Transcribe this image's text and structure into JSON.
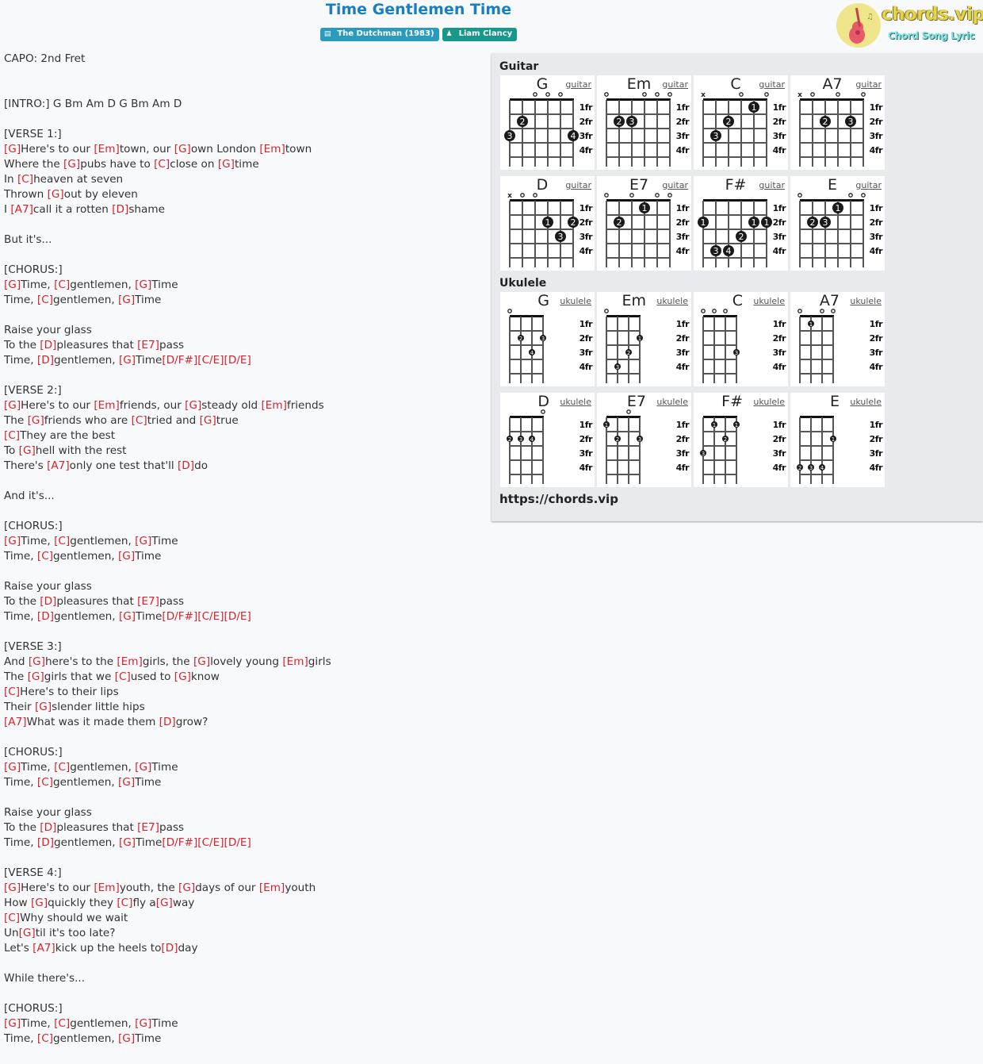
{
  "header": {
    "title": "Time Gentlemen Time",
    "album_badge": "The Dutchman (1983)",
    "artist_badge": "Liam Clancy",
    "album_icon": "book-icon",
    "artist_icon": "user-icon"
  },
  "logo": {
    "brand": "chords.vip",
    "tagline": "Chord Song Lyric",
    "icon": "guitar-icon"
  },
  "lyrics": [
    [
      {
        "t": "CAPO: 2nd Fret"
      }
    ],
    [],
    [],
    [
      {
        "t": "[INTRO:] G Bm Am D G Bm Am D"
      }
    ],
    [],
    [
      {
        "t": "[VERSE 1:]"
      }
    ],
    [
      {
        "c": "[G]"
      },
      {
        "t": "Here's to our "
      },
      {
        "c": "[Em]"
      },
      {
        "t": "town, our "
      },
      {
        "c": "[G]"
      },
      {
        "t": "own London "
      },
      {
        "c": "[Em]"
      },
      {
        "t": "town"
      }
    ],
    [
      {
        "t": "Where the "
      },
      {
        "c": "[G]"
      },
      {
        "t": "pubs have to "
      },
      {
        "c": "[C]"
      },
      {
        "t": "close on "
      },
      {
        "c": "[G]"
      },
      {
        "t": "time"
      }
    ],
    [
      {
        "t": "In "
      },
      {
        "c": "[C]"
      },
      {
        "t": "heaven at seven"
      }
    ],
    [
      {
        "t": "Thrown "
      },
      {
        "c": "[G]"
      },
      {
        "t": "out by eleven"
      }
    ],
    [
      {
        "t": "I "
      },
      {
        "c": "[A7]"
      },
      {
        "t": "call it a rotten "
      },
      {
        "c": "[D]"
      },
      {
        "t": "shame"
      }
    ],
    [],
    [
      {
        "t": "But it's..."
      }
    ],
    [],
    [
      {
        "t": "[CHORUS:]"
      }
    ],
    [
      {
        "c": "[G]"
      },
      {
        "t": "Time, "
      },
      {
        "c": "[C]"
      },
      {
        "t": "gentlemen, "
      },
      {
        "c": "[G]"
      },
      {
        "t": "Time"
      }
    ],
    [
      {
        "t": "Time, "
      },
      {
        "c": "[C]"
      },
      {
        "t": "gentlemen, "
      },
      {
        "c": "[G]"
      },
      {
        "t": "Time"
      }
    ],
    [],
    [
      {
        "t": "Raise your glass"
      }
    ],
    [
      {
        "t": "To the "
      },
      {
        "c": "[D]"
      },
      {
        "t": "pleasures that "
      },
      {
        "c": "[E7]"
      },
      {
        "t": "pass"
      }
    ],
    [
      {
        "t": "Time, "
      },
      {
        "c": "[D]"
      },
      {
        "t": "gentlemen, "
      },
      {
        "c": "[G]"
      },
      {
        "t": "Time"
      },
      {
        "c": "[D/F#]"
      },
      {
        "c": "[C/E]"
      },
      {
        "c": "[D/E]"
      }
    ],
    [],
    [
      {
        "t": "[VERSE 2:]"
      }
    ],
    [
      {
        "c": "[G]"
      },
      {
        "t": "Here's to our "
      },
      {
        "c": "[Em]"
      },
      {
        "t": "friends, our "
      },
      {
        "c": "[G]"
      },
      {
        "t": "steady old "
      },
      {
        "c": "[Em]"
      },
      {
        "t": "friends"
      }
    ],
    [
      {
        "t": "The "
      },
      {
        "c": "[G]"
      },
      {
        "t": "friends who are "
      },
      {
        "c": "[C]"
      },
      {
        "t": "tried and "
      },
      {
        "c": "[G]"
      },
      {
        "t": "true"
      }
    ],
    [
      {
        "c": "[C]"
      },
      {
        "t": "They are the best"
      }
    ],
    [
      {
        "t": "To "
      },
      {
        "c": "[G]"
      },
      {
        "t": "hell with the rest"
      }
    ],
    [
      {
        "t": "There's "
      },
      {
        "c": "[A7]"
      },
      {
        "t": "only one test that'll "
      },
      {
        "c": "[D]"
      },
      {
        "t": "do"
      }
    ],
    [],
    [
      {
        "t": "And it's..."
      }
    ],
    [],
    [
      {
        "t": "[CHORUS:]"
      }
    ],
    [
      {
        "c": "[G]"
      },
      {
        "t": "Time, "
      },
      {
        "c": "[C]"
      },
      {
        "t": "gentlemen, "
      },
      {
        "c": "[G]"
      },
      {
        "t": "Time"
      }
    ],
    [
      {
        "t": "Time, "
      },
      {
        "c": "[C]"
      },
      {
        "t": "gentlemen, "
      },
      {
        "c": "[G]"
      },
      {
        "t": "Time"
      }
    ],
    [],
    [
      {
        "t": "Raise your glass"
      }
    ],
    [
      {
        "t": "To the "
      },
      {
        "c": "[D]"
      },
      {
        "t": "pleasures that "
      },
      {
        "c": "[E7]"
      },
      {
        "t": "pass"
      }
    ],
    [
      {
        "t": "Time, "
      },
      {
        "c": "[D]"
      },
      {
        "t": "gentlemen, "
      },
      {
        "c": "[G]"
      },
      {
        "t": "Time"
      },
      {
        "c": "[D/F#]"
      },
      {
        "c": "[C/E]"
      },
      {
        "c": "[D/E]"
      }
    ],
    [],
    [
      {
        "t": "[VERSE 3:]"
      }
    ],
    [
      {
        "t": "And "
      },
      {
        "c": "[G]"
      },
      {
        "t": "here's to the "
      },
      {
        "c": "[Em]"
      },
      {
        "t": "girls, the "
      },
      {
        "c": "[G]"
      },
      {
        "t": "lovely young "
      },
      {
        "c": "[Em]"
      },
      {
        "t": "girls"
      }
    ],
    [
      {
        "t": "The "
      },
      {
        "c": "[G]"
      },
      {
        "t": "girls that we "
      },
      {
        "c": "[C]"
      },
      {
        "t": "used to "
      },
      {
        "c": "[G]"
      },
      {
        "t": "know"
      }
    ],
    [
      {
        "c": "[C]"
      },
      {
        "t": "Here's to their lips"
      }
    ],
    [
      {
        "t": "Their "
      },
      {
        "c": "[G]"
      },
      {
        "t": "slender little hips"
      }
    ],
    [
      {
        "c": "[A7]"
      },
      {
        "t": "What was it made them "
      },
      {
        "c": "[D]"
      },
      {
        "t": "grow?"
      }
    ],
    [],
    [
      {
        "t": "[CHORUS:]"
      }
    ],
    [
      {
        "c": "[G]"
      },
      {
        "t": "Time, "
      },
      {
        "c": "[C]"
      },
      {
        "t": "gentlemen, "
      },
      {
        "c": "[G]"
      },
      {
        "t": "Time"
      }
    ],
    [
      {
        "t": "Time, "
      },
      {
        "c": "[C]"
      },
      {
        "t": "gentlemen, "
      },
      {
        "c": "[G]"
      },
      {
        "t": "Time"
      }
    ],
    [],
    [
      {
        "t": "Raise your glass"
      }
    ],
    [
      {
        "t": "To the "
      },
      {
        "c": "[D]"
      },
      {
        "t": "pleasures that "
      },
      {
        "c": "[E7]"
      },
      {
        "t": "pass"
      }
    ],
    [
      {
        "t": "Time, "
      },
      {
        "c": "[D]"
      },
      {
        "t": "gentlemen, "
      },
      {
        "c": "[G]"
      },
      {
        "t": "Time"
      },
      {
        "c": "[D/F#]"
      },
      {
        "c": "[C/E]"
      },
      {
        "c": "[D/E]"
      }
    ],
    [],
    [
      {
        "t": "[VERSE 4:]"
      }
    ],
    [
      {
        "c": "[G]"
      },
      {
        "t": "Here's to our "
      },
      {
        "c": "[Em]"
      },
      {
        "t": "youth, the "
      },
      {
        "c": "[G]"
      },
      {
        "t": "days of our "
      },
      {
        "c": "[Em]"
      },
      {
        "t": "youth"
      }
    ],
    [
      {
        "t": "How "
      },
      {
        "c": "[G]"
      },
      {
        "t": "quickly they "
      },
      {
        "c": "[C]"
      },
      {
        "t": "fly a"
      },
      {
        "c": "[G]"
      },
      {
        "t": "way"
      }
    ],
    [
      {
        "c": "[C]"
      },
      {
        "t": "Why should we wait"
      }
    ],
    [
      {
        "t": "Un"
      },
      {
        "c": "[G]"
      },
      {
        "t": "til it's too late?"
      }
    ],
    [
      {
        "t": "Let's "
      },
      {
        "c": "[A7]"
      },
      {
        "t": "kick up the heels to"
      },
      {
        "c": "[D]"
      },
      {
        "t": "day"
      }
    ],
    [],
    [
      {
        "t": "While there's..."
      }
    ],
    [],
    [
      {
        "t": "[CHORUS:]"
      }
    ],
    [
      {
        "c": "[G]"
      },
      {
        "t": "Time, "
      },
      {
        "c": "[C]"
      },
      {
        "t": "gentlemen, "
      },
      {
        "c": "[G]"
      },
      {
        "t": "Time"
      }
    ],
    [
      {
        "t": "Time, "
      },
      {
        "c": "[C]"
      },
      {
        "t": "gentlemen, "
      },
      {
        "c": "[G]"
      },
      {
        "t": "Time"
      }
    ]
  ],
  "panel": {
    "guitar_label": "Guitar",
    "ukulele_label": "Ukulele",
    "url": "https://chords.vip",
    "fret_labels": [
      "1fr",
      "2fr",
      "3fr",
      "4fr"
    ],
    "guitar_chords": [
      {
        "name": "G",
        "inst": "guitar",
        "open": [
          null,
          null,
          "o",
          "o",
          "o",
          null
        ],
        "dots": [
          [
            1,
            2,
            "2"
          ],
          [
            0,
            3,
            "3"
          ],
          [
            5,
            3,
            "4"
          ]
        ]
      },
      {
        "name": "Em",
        "inst": "guitar",
        "open": [
          "o",
          null,
          null,
          "o",
          "o",
          "o"
        ],
        "dots": [
          [
            1,
            2,
            "2"
          ],
          [
            2,
            2,
            "3"
          ]
        ]
      },
      {
        "name": "C",
        "inst": "guitar",
        "open": [
          "x",
          null,
          null,
          "o",
          null,
          "o"
        ],
        "dots": [
          [
            4,
            1,
            "1"
          ],
          [
            2,
            2,
            "2"
          ],
          [
            1,
            3,
            "3"
          ]
        ]
      },
      {
        "name": "A7",
        "inst": "guitar",
        "open": [
          "x",
          "o",
          null,
          "o",
          null,
          "o"
        ],
        "dots": [
          [
            2,
            2,
            "2"
          ],
          [
            4,
            2,
            "3"
          ]
        ]
      },
      {
        "name": "D",
        "inst": "guitar",
        "open": [
          "x",
          "o",
          "o",
          null,
          null,
          null
        ],
        "dots": [
          [
            3,
            2,
            "1"
          ],
          [
            5,
            2,
            "2"
          ],
          [
            4,
            3,
            "3"
          ]
        ]
      },
      {
        "name": "E7",
        "inst": "guitar",
        "open": [
          "o",
          null,
          "o",
          null,
          "o",
          "o"
        ],
        "dots": [
          [
            3,
            1,
            "1"
          ],
          [
            1,
            2,
            "2"
          ]
        ]
      },
      {
        "name": "F#",
        "inst": "guitar",
        "open": [
          null,
          null,
          null,
          null,
          null,
          null
        ],
        "dots": [
          [
            0,
            2,
            "1"
          ],
          [
            4,
            2,
            "1"
          ],
          [
            5,
            2,
            "1"
          ],
          [
            3,
            3,
            "2"
          ],
          [
            1,
            4,
            "3"
          ],
          [
            2,
            4,
            "4"
          ]
        ]
      },
      {
        "name": "E",
        "inst": "guitar",
        "open": [
          "o",
          null,
          null,
          null,
          "o",
          "o"
        ],
        "dots": [
          [
            3,
            1,
            "1"
          ],
          [
            1,
            2,
            "2"
          ],
          [
            2,
            2,
            "3"
          ]
        ]
      }
    ],
    "ukulele_chords": [
      {
        "name": "G",
        "inst": "ukulele",
        "open": [
          "o",
          null,
          null,
          null
        ],
        "dots": [
          [
            1,
            2,
            "2"
          ],
          [
            3,
            2,
            "3"
          ],
          [
            2,
            3,
            "4"
          ]
        ]
      },
      {
        "name": "Em",
        "inst": "ukulele",
        "open": [
          "o",
          null,
          null,
          null
        ],
        "dots": [
          [
            3,
            2,
            "1"
          ],
          [
            2,
            3,
            "2"
          ],
          [
            1,
            4,
            "3"
          ]
        ]
      },
      {
        "name": "C",
        "inst": "ukulele",
        "open": [
          "o",
          "o",
          "o",
          null
        ],
        "dots": [
          [
            3,
            3,
            "3"
          ]
        ]
      },
      {
        "name": "A7",
        "inst": "ukulele",
        "open": [
          "o",
          null,
          "o",
          "o"
        ],
        "dots": [
          [
            1,
            1,
            "1"
          ]
        ]
      },
      {
        "name": "D",
        "inst": "ukulele",
        "open": [
          null,
          null,
          null,
          "o"
        ],
        "dots": [
          [
            0,
            2,
            "2"
          ],
          [
            1,
            2,
            "3"
          ],
          [
            2,
            2,
            "4"
          ]
        ]
      },
      {
        "name": "E7",
        "inst": "ukulele",
        "open": [
          null,
          null,
          "o",
          null
        ],
        "dots": [
          [
            0,
            1,
            "1"
          ],
          [
            1,
            2,
            "2"
          ],
          [
            3,
            2,
            "3"
          ]
        ]
      },
      {
        "name": "F#",
        "inst": "ukulele",
        "open": [
          null,
          null,
          null,
          null
        ],
        "dots": [
          [
            1,
            1,
            "1"
          ],
          [
            3,
            1,
            "1"
          ],
          [
            2,
            2,
            "2"
          ],
          [
            0,
            3,
            "3"
          ]
        ]
      },
      {
        "name": "E",
        "inst": "ukulele",
        "open": [
          null,
          null,
          null,
          null
        ],
        "dots": [
          [
            3,
            2,
            "1"
          ],
          [
            0,
            4,
            "2"
          ],
          [
            1,
            4,
            "3"
          ],
          [
            2,
            4,
            "4"
          ]
        ]
      }
    ]
  },
  "colors": {
    "title": "#1a7fc0",
    "chord": "#d8232a",
    "album_badge": "#2b9bbd",
    "artist_badge": "#16998a"
  }
}
